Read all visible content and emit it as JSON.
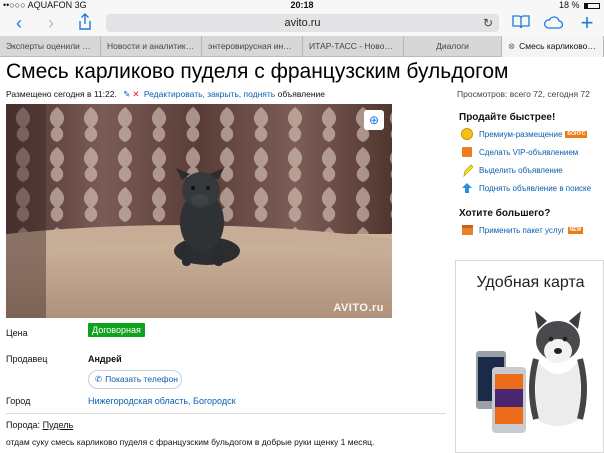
{
  "statusbar": {
    "carrier": "••○○○ AQUAFON 3G",
    "time": "20:18",
    "battery": "18 %",
    "battery_level": 0.18
  },
  "browser": {
    "url": "avito.ru",
    "tabs": [
      {
        "label": "Эксперты оценили ст..."
      },
      {
        "label": "Новости и аналитика..."
      },
      {
        "label": "энтеровирусная инфе..."
      },
      {
        "label": "ИТАР-ТАСС - Новости..."
      },
      {
        "label": "Диалоги"
      },
      {
        "label": "Смесь карликово пуд..."
      }
    ]
  },
  "listing": {
    "title": "Смесь карликово пуделя с французским бульдогом",
    "posted": "Размещено сегодня в 11:22.",
    "actions_link": "Редактировать, закрыть, поднять",
    "actions_suffix": "объявление",
    "views": "Просмотров: всего 72, сегодня 72",
    "watermark": "AVITO.ru",
    "price_label": "Цена",
    "price_value": "Договорная",
    "seller_label": "Продавец",
    "seller_name": "Андрей",
    "phone_button": "Показать телефон",
    "city_label": "Город",
    "city_value": "Нижегородская область, Богородск",
    "breed_label": "Порода:",
    "breed_value": "Пудель",
    "description": "отдам суку смесь карликово пуделя с французским бульдогом в добрые руки щенку 1 месяц."
  },
  "sidebar": {
    "sell_faster_title": "Продайте быстрее!",
    "sell_items": [
      {
        "label": "Премиум-размещение",
        "badge": "БОНУС",
        "icon": "gold-coin-icon"
      },
      {
        "label": "Сделать VIP-объявлением",
        "icon": "vip-icon"
      },
      {
        "label": "Выделить объявление",
        "icon": "highlighter-icon"
      },
      {
        "label": "Поднять объявление в поиске",
        "icon": "arrow-up-icon"
      }
    ],
    "want_more_title": "Хотите большего?",
    "package_item": {
      "label": "Применить пакет услуг",
      "badge": "NEW",
      "icon": "package-icon"
    }
  },
  "ad": {
    "title": "Удобная карта"
  },
  "colors": {
    "link": "#0a5fb0",
    "price_badge": "#10a21e",
    "ios_blue": "#1a7be0"
  }
}
